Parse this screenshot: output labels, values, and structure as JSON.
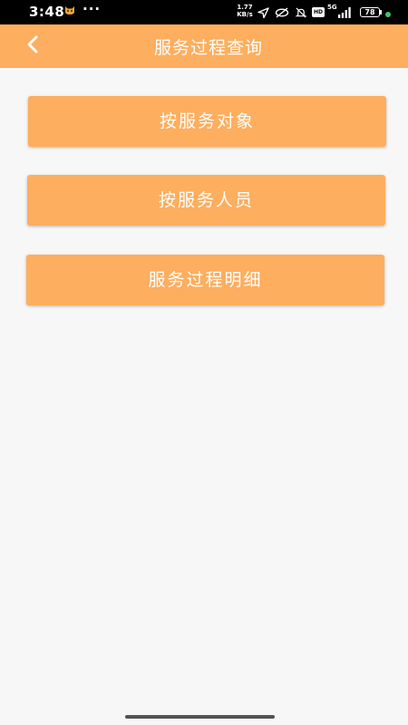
{
  "status_bar": {
    "time": "3:48",
    "more": "···",
    "net_speed_value": "1.77",
    "net_speed_unit": "KB/s",
    "hd": "HD",
    "network": "5G",
    "battery": "78",
    "icons": [
      "cat-icon",
      "location-arrow-icon",
      "hotspot-icon",
      "mute-bell-icon",
      "signal-icon",
      "battery-icon"
    ]
  },
  "header": {
    "back_icon": "chevron-left-icon",
    "title": "服务过程查询"
  },
  "menu": {
    "items": [
      {
        "label": "按服务对象"
      },
      {
        "label": "按服务人员"
      },
      {
        "label": "服务过程明细"
      }
    ]
  },
  "colors": {
    "accent": "#fdae5e",
    "background": "#f7f7f7",
    "text_on_accent": "#ffffff"
  }
}
